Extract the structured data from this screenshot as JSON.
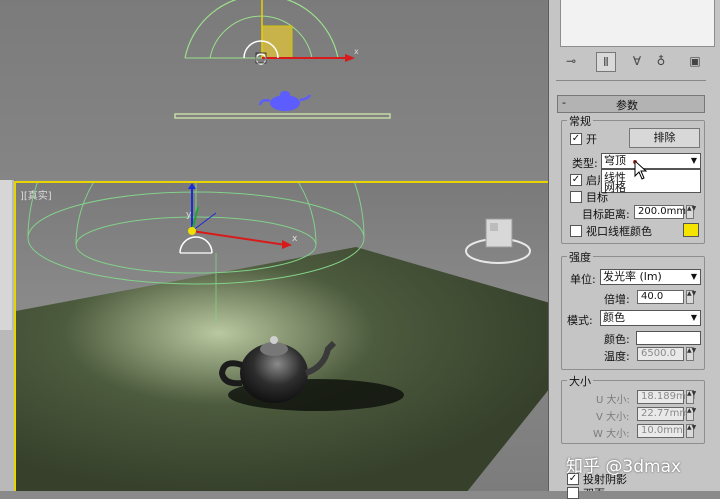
{
  "viewport_top": {
    "axis_label": "x"
  },
  "viewport_persp": {
    "label": "][真实]",
    "axis_x": "x",
    "axis_y": "y"
  },
  "panel": {
    "rollout_title": "参数",
    "rollout_collapse": "-",
    "toolbar_icons": [
      "pin-icon",
      "pipe-icon",
      "fork-icon",
      "lock-icon",
      "config-icon"
    ],
    "general": {
      "title": "常规",
      "on_label": "开",
      "on_checked": true,
      "exclude_button": "排除",
      "type_label": "类型:",
      "type_value": "穹顶",
      "type_options": [
        "线性",
        "网格"
      ],
      "enable_label": "启用",
      "enable_checked": true,
      "target_label": "目标",
      "target_checked": false,
      "target_distance_label": "目标距离:",
      "target_distance_value": "200.0mm",
      "viewport_wire_label": "视口线框颜色",
      "viewport_wire_checked": false,
      "viewport_wire_color": "#f5e400"
    },
    "intensity": {
      "title": "强度",
      "unit_label": "单位:",
      "unit_value": "发光率 (lm)",
      "multiplier_label": "倍增:",
      "multiplier_value": "40.0",
      "mode_label": "模式:",
      "mode_value": "颜色",
      "color_label": "颜色:",
      "color_value": "#ffffff",
      "temperature_label": "温度:",
      "temperature_value": "6500.0"
    },
    "size": {
      "title": "大小",
      "u_label": "U 大小:",
      "u_value": "18.189mm",
      "v_label": "V 大小:",
      "v_value": "22.77mm",
      "w_label": "W 大小:",
      "w_value": "10.0mm"
    },
    "cast_shadows_label": "投射阴影",
    "cast_shadows_checked": true,
    "cut_label": "双面"
  },
  "watermark": "知乎 @3dmax"
}
